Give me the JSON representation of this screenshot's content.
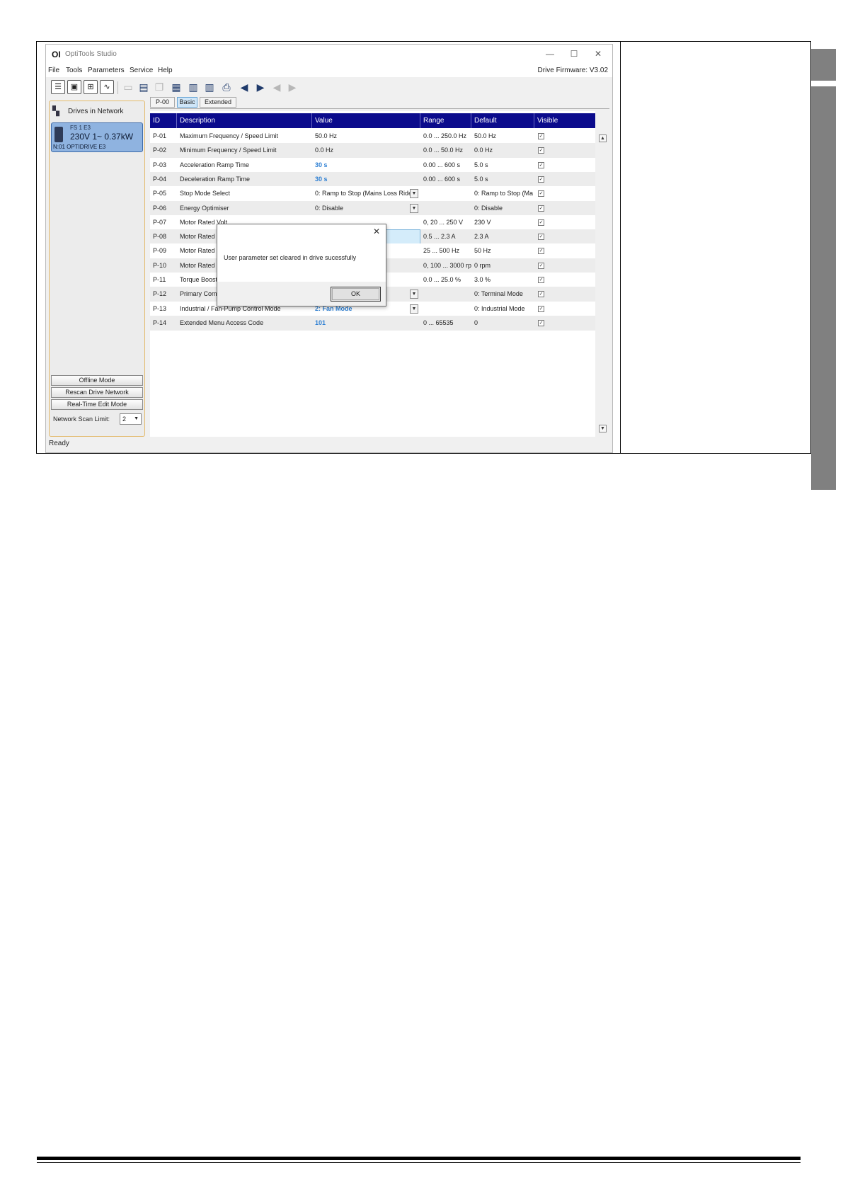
{
  "window": {
    "title": "OptiTools Studio",
    "logo": "OI",
    "minimize_glyph": "—",
    "maximize_glyph": "☐",
    "close_glyph": "✕"
  },
  "menu": {
    "items": [
      "File",
      "Tools",
      "Parameters",
      "Service",
      "Help"
    ],
    "firmware": "Drive Firmware: V3.02"
  },
  "toolbar": {
    "icons": [
      "list-icon",
      "monitor-icon",
      "scope-icon",
      "waveform-icon",
      "open-folder-icon",
      "save-icon",
      "copy-icon",
      "compare-icon",
      "upload-drive-icon",
      "download-drive-icon",
      "print-icon",
      "read-from-drive-icon",
      "write-to-drive-icon",
      "read-disabled-icon",
      "write-disabled-icon"
    ]
  },
  "left_panel": {
    "header": "Drives in Network",
    "drive": {
      "line1": "FS 1  E3",
      "line2": "230V 1~  0.37kW",
      "line3": "N:01  OPTIDRIVE E3"
    },
    "buttons": [
      "Offline Mode",
      "Rescan Drive Network",
      "Real-Time Edit Mode"
    ],
    "scan_label": "Network Scan Limit:",
    "scan_value": "2"
  },
  "tabs": [
    {
      "label": "P-00",
      "active": false
    },
    {
      "label": "Basic",
      "active": true
    },
    {
      "label": "Extended",
      "active": false
    }
  ],
  "table": {
    "headers": [
      "ID",
      "Description",
      "Value",
      "Range",
      "Default",
      "Visible"
    ],
    "rows": [
      {
        "id": "P-01",
        "desc": "Maximum Frequency / Speed Limit",
        "value": "50.0 Hz",
        "range": "0.0 ... 250.0 Hz",
        "default": "50.0 Hz",
        "modified": false,
        "dropdown": false
      },
      {
        "id": "P-02",
        "desc": "Minimum Frequency / Speed Limit",
        "value": "0.0 Hz",
        "range": "0.0 ... 50.0 Hz",
        "default": "0.0 Hz",
        "modified": false,
        "dropdown": false
      },
      {
        "id": "P-03",
        "desc": "Acceleration Ramp Time",
        "value": "30 s",
        "range": "0.00 ... 600 s",
        "default": "5.0 s",
        "modified": true,
        "dropdown": false
      },
      {
        "id": "P-04",
        "desc": "Deceleration Ramp Time",
        "value": "30 s",
        "range": "0.00 ... 600 s",
        "default": "5.0 s",
        "modified": true,
        "dropdown": false
      },
      {
        "id": "P-05",
        "desc": "Stop Mode Select",
        "value": "0: Ramp to Stop (Mains Loss Ride",
        "range": "",
        "default": "0: Ramp to Stop (Ma",
        "modified": false,
        "dropdown": true
      },
      {
        "id": "P-06",
        "desc": "Energy Optimiser",
        "value": "0: Disable",
        "range": "",
        "default": "0: Disable",
        "modified": false,
        "dropdown": true
      },
      {
        "id": "P-07",
        "desc": "Motor Rated Volt",
        "value": "",
        "range": "0, 20 ... 250 V",
        "default": "230 V",
        "modified": false,
        "dropdown": false
      },
      {
        "id": "P-08",
        "desc": "Motor Rated Cur",
        "value": "",
        "range": "0.5 ... 2.3 A",
        "default": "2.3 A",
        "modified": false,
        "dropdown": false,
        "editing": true
      },
      {
        "id": "P-09",
        "desc": "Motor Rated Fre",
        "value": "",
        "range": "25 ... 500 Hz",
        "default": "50 Hz",
        "modified": false,
        "dropdown": false
      },
      {
        "id": "P-10",
        "desc": "Motor Rated Spe",
        "value": "",
        "range": "0, 100 ... 3000 rp",
        "default": "0 rpm",
        "modified": false,
        "dropdown": false
      },
      {
        "id": "P-11",
        "desc": "Torque Boost",
        "value": "",
        "range": "0.0 ... 25.0 %",
        "default": "3.0 %",
        "modified": false,
        "dropdown": false
      },
      {
        "id": "P-12",
        "desc": "Primary Comman",
        "value": "",
        "range": "",
        "default": "0: Terminal Mode",
        "modified": false,
        "dropdown": true
      },
      {
        "id": "P-13",
        "desc": "Industrial / Fan-Pump Control Mode",
        "value": "2: Fan Mode",
        "range": "",
        "default": "0: Industrial Mode",
        "modified": true,
        "dropdown": true
      },
      {
        "id": "P-14",
        "desc": "Extended Menu Access Code",
        "value": "101",
        "range": "0 ... 65535",
        "default": "0",
        "modified": true,
        "dropdown": false
      }
    ],
    "check_glyph": "✓",
    "dropdown_glyph": "▼"
  },
  "status": "Ready",
  "dialog": {
    "message": "User parameter set cleared in drive sucessfully",
    "ok_label": "OK",
    "close_glyph": "✕"
  },
  "colors": {
    "header_bg": "#0b0b8c",
    "modified_value": "#2d7fd3",
    "selected_drive": "#8fb3e0"
  }
}
